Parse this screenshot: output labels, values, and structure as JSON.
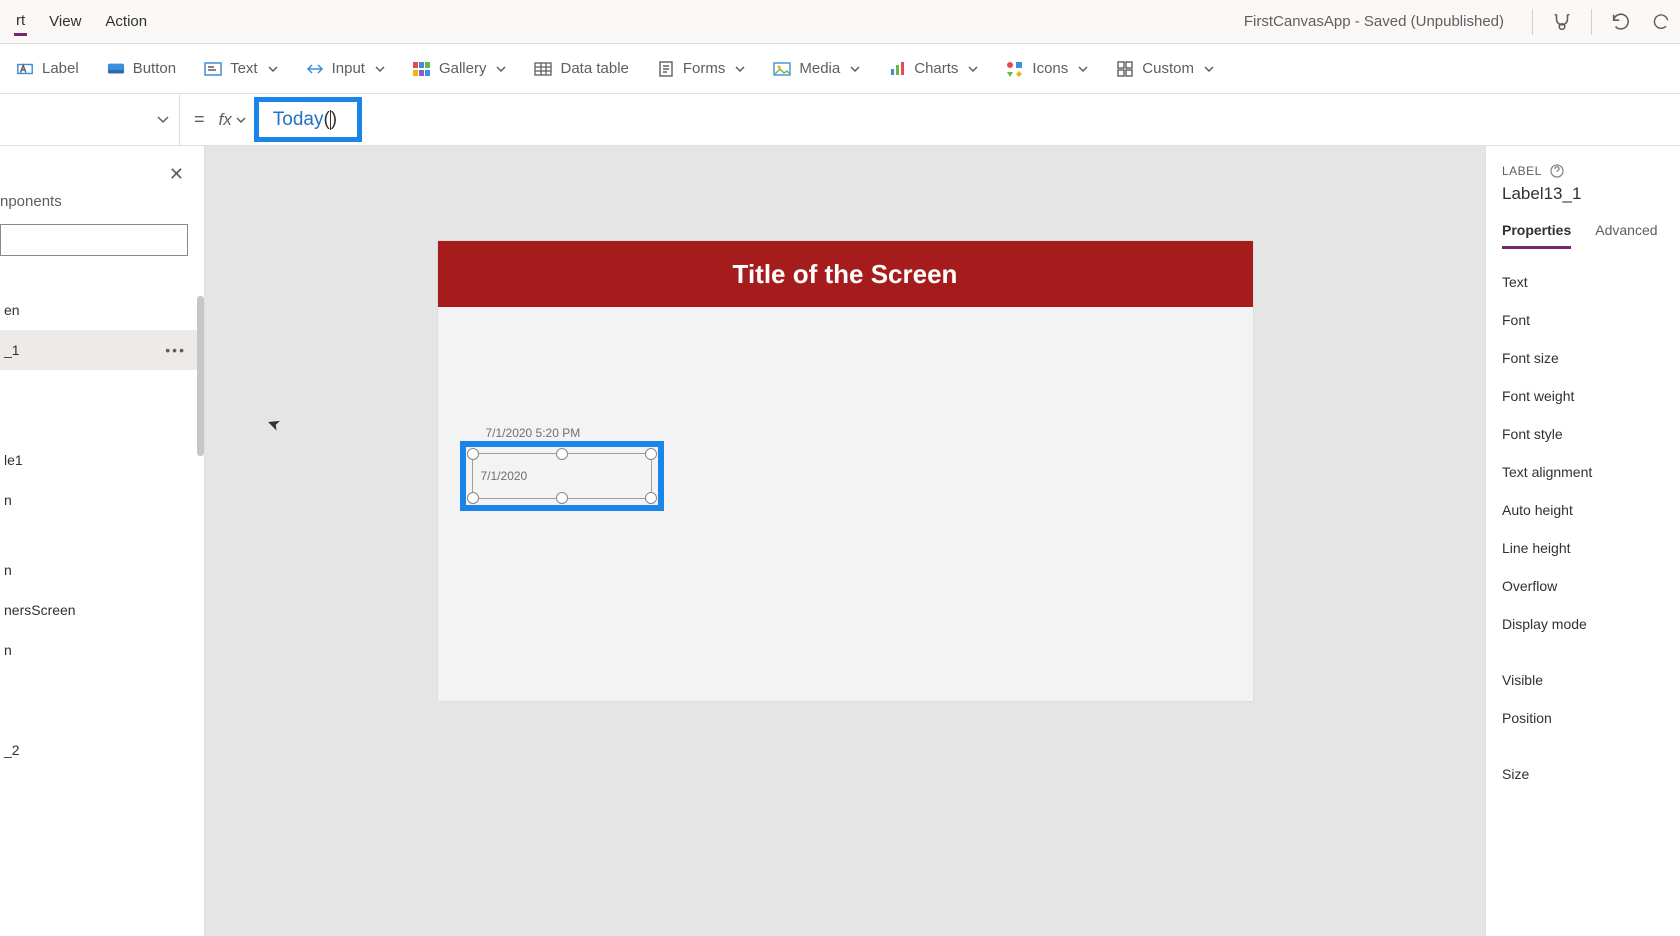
{
  "menubar": {
    "items": [
      "rt",
      "View",
      "Action"
    ],
    "app_title": "FirstCanvasApp - Saved (Unpublished)"
  },
  "ribbon": {
    "label": "Label",
    "button": "Button",
    "text": "Text",
    "input": "Input",
    "gallery": "Gallery",
    "data_table": "Data table",
    "forms": "Forms",
    "media": "Media",
    "charts": "Charts",
    "icons": "Icons",
    "custom": "Custom"
  },
  "formula": {
    "eq": "=",
    "fx": "fx",
    "fn": "Today",
    "open": "(",
    "close": ")"
  },
  "left_panel": {
    "tab": "nponents",
    "items": [
      "en",
      "_1",
      "le1",
      "n",
      "n",
      "nersScreen",
      "n",
      "_2"
    ],
    "selected_index": 1
  },
  "canvas": {
    "screen_title": "Title of the Screen",
    "label_a_text": "7/1/2020 5:20 PM",
    "label_b_text": "7/1/2020"
  },
  "right_panel": {
    "type": "LABEL",
    "name": "Label13_1",
    "tabs": [
      "Properties",
      "Advanced"
    ],
    "props_a": [
      "Text",
      "Font",
      "Font size",
      "Font weight",
      "Font style",
      "Text alignment",
      "Auto height",
      "Line height",
      "Overflow",
      "Display mode"
    ],
    "props_b": [
      "Visible",
      "Position",
      "Size"
    ]
  }
}
